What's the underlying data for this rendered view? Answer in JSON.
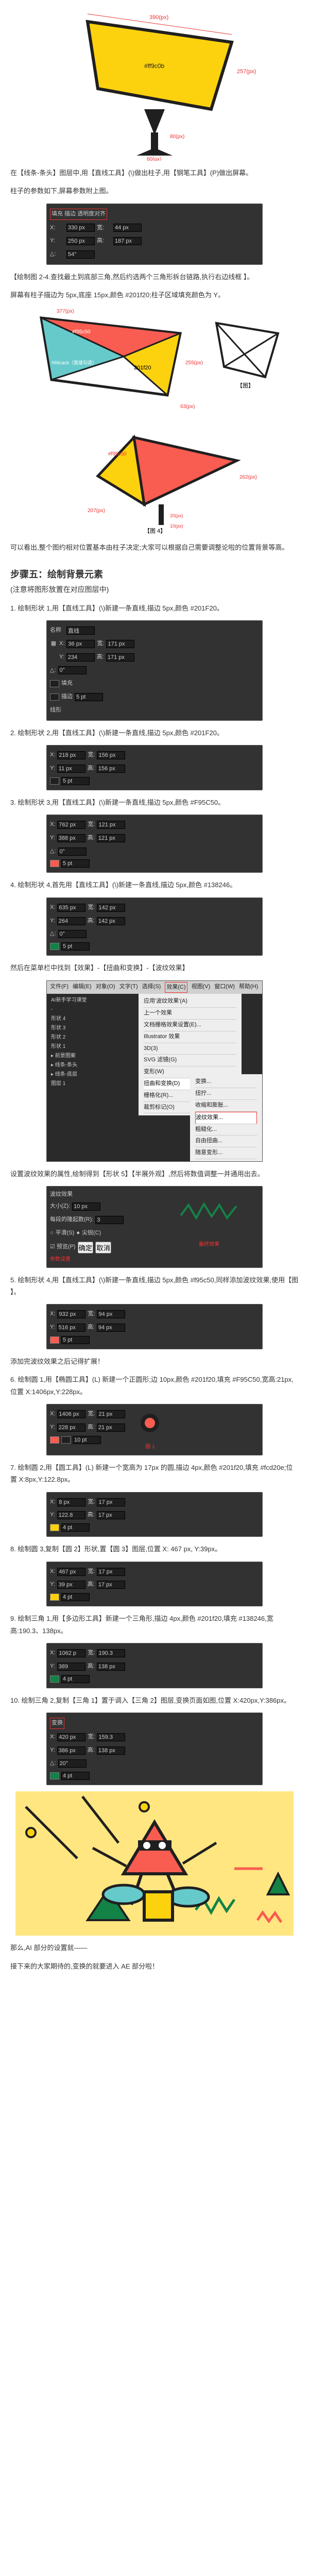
{
  "intro_fig": {
    "top_dim": "390(px)",
    "side_dim": "257(px)",
    "fill_note": "#ff9c0b",
    "base_w": "60(px)",
    "base_h": "80(px)",
    "base_color": "#201f20"
  },
  "p1": "在【线条-条头】图层中,用【直线工具】(\\)做出柱子,用【钢笔工具】(P)做出屏幕。",
  "p2": "柱子的参数如下,屏幕参数附上图。",
  "panel1": {
    "title": "填充 描边 透明度对齐",
    "xw": "330 px",
    "yh": "250 px",
    "ang": "54°",
    "wv": "44 px",
    "hv": "187 px"
  },
  "p3": "【绘制图 2-4.查找最土到底部三角,然后约选两个三角形拆台链路,执行右边线框 】。",
  "p4": "屏幕有柱子描边为 5px,底座 15px,颜色 #201f20;柱子区域填充颜色为 Y。",
  "fig2": {
    "box1": "#f95c50",
    "box2": "#66cacb（直接勾选）",
    "box3": "201f20",
    "dimA": "377(px)",
    "dimB": "255(px)",
    "dimC": "63(px)",
    "right_note": "【图】"
  },
  "fig3": {
    "label": "#f95c50",
    "dimA": "207(px)",
    "dimB": "262(px)",
    "s1": "20(px)",
    "s2": "10(px)",
    "note": "【图 4】"
  },
  "p5": "可以看出,整个图约相对位置基本由柱子决定;大家可以根据自己需要调整论啦的位置背景等高。",
  "step5_h": "步骤五：绘制背景元素",
  "step5_sub": "(注意将图形放置在对应图层中)",
  "s5_1": "1. 绘制形状 1,用【直线工具】(\\)新建一条直线,描边 5px,颜色 #201F20。",
  "panelA": {
    "label_name": "名称",
    "name_val": "直线",
    "x": "36 px",
    "y": "234",
    "w": "171 px",
    "h": "171 px",
    "ang": "0°",
    "stroke": "5 pt",
    "desc": "描边",
    "filllbl": "填充",
    "ext": "线形"
  },
  "s5_2": "2. 绘制形状 2,用【直线工具】(\\)新建一条直线,描边 5px,颜色 #201F20。",
  "panelB": {
    "x": "218 px",
    "y": "11 px",
    "w": "156 px",
    "h": "156 px",
    "stroke": "5 pt"
  },
  "s5_3": "3. 绘制形状 3,用【直线工具】(\\)新建一条直线,描边 5px,颜色 #F95C50。",
  "panelC": {
    "x": "762 px",
    "y": "388 px",
    "w": "121 px",
    "h": "121 px",
    "stroke": "5 pt",
    "ang": "0°"
  },
  "s5_4": "4. 绘制形状 4,首先用【直线工具】(\\)新建一条直线,描边 5px,颜色 #138246。",
  "panelD": {
    "x": "635 px",
    "y": "264",
    "w": "142 px",
    "h": "142 px",
    "stroke": "5 pt",
    "ang": "0°"
  },
  "p_menu": "然后在菜单栏中找到【效果】-【扭曲和变换】-【波纹效果】",
  "menu": {
    "bar": [
      "文件(F)",
      "编辑(E)",
      "对象(O)",
      "文字(T)",
      "选择(S)",
      "效果(C)",
      "视图(V)",
      "窗口(W)",
      "帮助(H)"
    ],
    "drop": [
      "应用'波纹效果'(A)",
      "上一个效果",
      "文档栅格效果设置(E)...",
      "Illustrator 效果",
      "3D(3)",
      "SVG 滤镜(G)",
      "变形(W)",
      "扭曲和变换(D)",
      "栅格化(R)...",
      "裁剪标记(O)"
    ],
    "sub": [
      "变换...",
      "扭拧...",
      "收缩和膨胀...",
      "波纹效果...",
      "粗糙化...",
      "自由扭曲...",
      "随意变形..."
    ],
    "left": [
      "AI新手学习课堂",
      "-",
      "形状 4",
      "形状 3",
      "形状 2",
      "形状 1",
      "▸ 前景图案",
      "▸ 线条-条头",
      "▸ 线条-底层",
      "图层 1"
    ]
  },
  "p_dialog": "设置波纹效果的属性,绘制得到【形状 5】【半展外观】,然后将数值调整一并通用出去。",
  "panelE": {
    "title": "波纹效果",
    "size_lbl": "大小(Z):",
    "size_val": "10 px",
    "seg_lbl": "每段的隆起数(R):",
    "seg_val": "3",
    "opt1": "平滑(S)",
    "opt2": "尖锐(C)",
    "preview": "☑ 预览(P)",
    "ok": "确定",
    "cancel": "取消",
    "end_lbl": "参数设置",
    "res_lbl": "最终效果"
  },
  "s5_5": "5. 绘制形状 4,用【直线工具】(\\)新建一条直线,描边 5px,颜色 #f95c50,同样添加波纹效果,使用【图 】。",
  "panelF": {
    "x": "932 px",
    "y": "516 px",
    "w": "94 px",
    "h": "94 px",
    "stroke": "5 pt"
  },
  "p_expand": "添加完波纹效果之后记得扩展！",
  "s5_6": "6. 绘制圆 1,用【椭圆工具】(L) 新建一个正圆形;边 10px,颜色 #201f20,填充 #F95C50,宽高:21px,位置 X:1406px,Y:228px。",
  "panelG": {
    "x": "1406 px",
    "y": "228 px",
    "w": "21 px",
    "h": "21 px",
    "stroke": "10 pt",
    "c_box": "圆 1"
  },
  "s5_7": "7. 绘制圆 2,用【圆工具】(L) 新建一个宽高为 17px 的圆,描边 4px,颜色 #201f20,填充 #fcd20e;位置 X:8px,Y:122.8px。",
  "panelH": {
    "x": "8 px",
    "y": "122.8",
    "w": "17 px",
    "h": "17 px",
    "stroke": "4 pt"
  },
  "s5_8": "8. 绘制圆 3,复制【圆 2】形状,置【圆 3】图层,位置 X: 467 px, Y:39px。",
  "panelI": {
    "x": "467 px",
    "y": "39 px",
    "w": "17 px",
    "h": "17 px",
    "stroke": "4 pt"
  },
  "s5_9": "9. 绘制三角 1,用【多边形工具】新建一个三角形,描边 4px,颜色 #201f20,填充 #138246,宽高:190.3、138px。",
  "panelJ": {
    "x": "1062 p",
    "y": "389",
    "w": "190.3",
    "h": "138 px",
    "stroke": "4 pt"
  },
  "s5_10": "10. 绘制三角 2,复制【三角 1】置于调入【三角 2】图层,变换页面如图,位置 X:420px,Y:386px。",
  "panelK": {
    "x": "420 px",
    "y": "386 px",
    "w": "159.3",
    "h": "138 px",
    "stroke": "4 pt",
    "ang": "20°",
    "hl_lbl": "变换"
  },
  "final_p1": "那么,AI 部分的设置就——",
  "final_p2": "接下来的大家期待的,变换的就要进入 AE 部分啦！"
}
